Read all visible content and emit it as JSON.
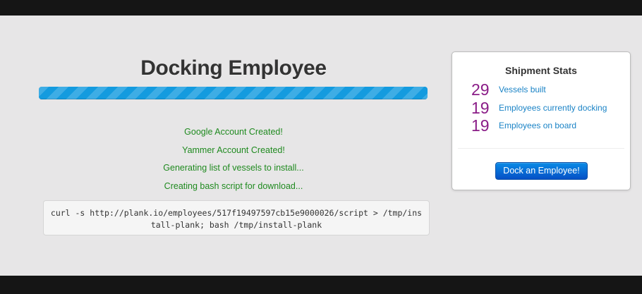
{
  "page": {
    "title": "Docking Employee",
    "progress_percent": 100
  },
  "status_messages": [
    "Google Account Created!",
    "Yammer Account Created!",
    "Generating list of vessels to install...",
    "Creating bash script for download..."
  ],
  "script": {
    "command": "curl -s http://plank.io/employees/517f19497597cb15e9000026/script > /tmp/install-plank; bash /tmp/install-plank"
  },
  "stats": {
    "title": "Shipment Stats",
    "items": [
      {
        "value": "29",
        "label": "Vessels built"
      },
      {
        "value": "19",
        "label": "Employees currently docking"
      },
      {
        "value": "19",
        "label": "Employees on board"
      }
    ],
    "button_label": "Dock an Employee!"
  },
  "colors": {
    "progress": "#149bdf",
    "status_text": "#1f8a1f",
    "stat_value": "#8a1c87",
    "stat_label": "#1a83c6",
    "button": "#0a6fd8"
  }
}
